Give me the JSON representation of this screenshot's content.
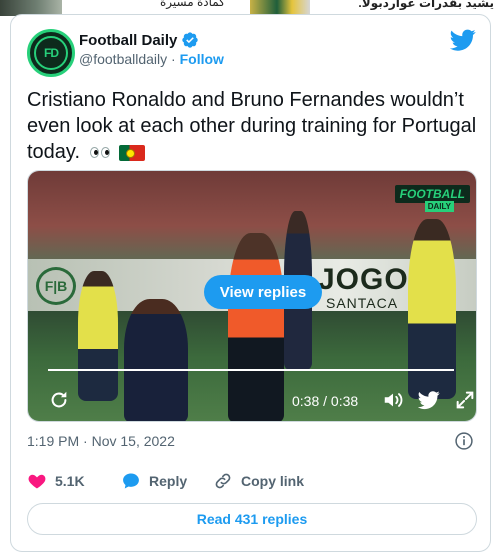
{
  "top_banner": {
    "left_text": "كمادة مسيرة",
    "right_text": "يشيد بقدرات غواردبولا."
  },
  "tweet": {
    "author": {
      "display_name": "Football Daily",
      "handle": "@footballdaily",
      "separator": "·",
      "follow_label": "Follow",
      "avatar_text": "FD",
      "verified": true
    },
    "text": "Cristiano Ronaldo and Bruno Fernandes wouldn’t even look at each other during training for Portugal today.",
    "emoji": [
      "eyes-icon",
      "portugal-flag-icon"
    ],
    "media": {
      "overlay_button_label": "View replies",
      "brand_badge": "FOOTBALL",
      "brand_badge_sub": "DAILY",
      "hoarding_text": "JOGOS",
      "hoarding_sub": "SANTACA",
      "hoarding_logo": "F|B",
      "time_display": "0:38 / 0:38",
      "progress": 1.0
    },
    "timestamp": "1:19 PM · Nov 15, 2022",
    "actions": {
      "likes": "5.1K",
      "reply_label": "Reply",
      "copy_link_label": "Copy link"
    },
    "read_replies_label": "Read 431 replies"
  },
  "colors": {
    "accent": "#1d9bf0",
    "like": "#f91880",
    "brand_green": "#27d07a",
    "text_secondary": "#536471"
  }
}
